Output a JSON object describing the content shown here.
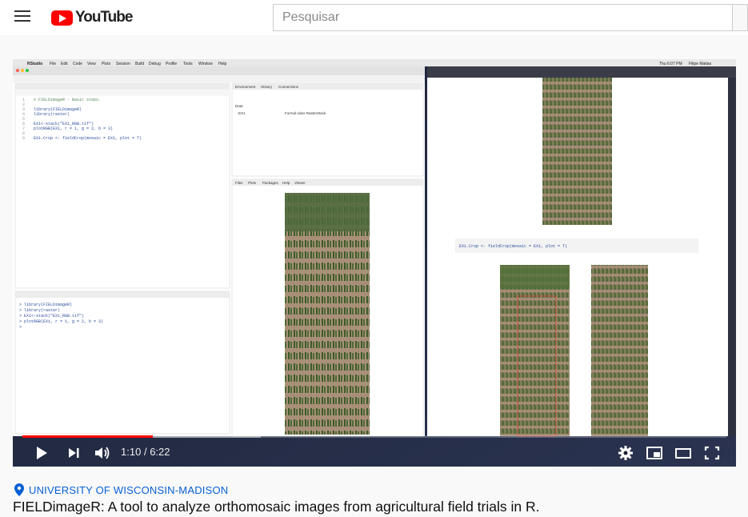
{
  "header": {
    "logo_text": "YouTube",
    "search_placeholder": "Pesquisar"
  },
  "player": {
    "time_current": "1:10",
    "time_separator": "/",
    "time_total": "6:22",
    "progress_fraction": 0.183,
    "buffer_fraction": 0.339
  },
  "video_frame": {
    "menubar_app": "RStudio",
    "menubar_items": [
      "File",
      "Edit",
      "Code",
      "View",
      "Plots",
      "Session",
      "Build",
      "Debug",
      "Profile",
      "Tools",
      "Window",
      "Help"
    ],
    "menubar_clock": "Thu 6:07 PM",
    "editor_lines": [
      "# FIELDimageR - Basic steps.",
      "",
      "library(FIELDimageR)",
      "library(raster)",
      "",
      "EX1<-stack(\"EX1_RGB.tif\")",
      "plotRGB(EX1, r = 1, g = 2, b = 3)",
      "",
      "EX1.Crop <- fieldCrop(mosaic = EX1, plot = T)"
    ],
    "console_lines": [
      "> library(FIELDimageR)",
      "> library(raster)",
      "> EX1<-stack(\"EX1_RGB.tif\")",
      "> plotRGB(EX1, r = 1, g = 2, b = 3)",
      ">"
    ],
    "env_tabs": [
      "Environment",
      "History",
      "Connections"
    ],
    "env_row_name": "EX1",
    "env_row_value": "Formal class RasterStack",
    "env_section": "Data",
    "files_tabs": [
      "Files",
      "Plots",
      "Packages",
      "Help",
      "Viewer"
    ],
    "right_code": "EX1.Crop <- fieldCrop(mosaic = EX1, plot = T)"
  },
  "channel": {
    "name": "UNIVERSITY OF WISCONSIN-MADISON"
  },
  "video": {
    "title": "FIELDimageR: A tool to analyze orthomosaic images from agricultural field trials in R."
  },
  "colors": {
    "accent": "#ff0000",
    "link": "#065fd4"
  }
}
